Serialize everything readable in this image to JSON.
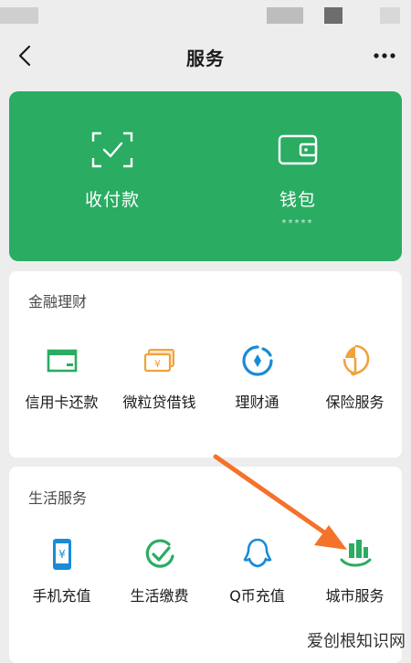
{
  "header": {
    "title": "服务"
  },
  "wallet": {
    "pay_label": "收付款",
    "wallet_label": "钱包",
    "balance_masked": "*****"
  },
  "finance": {
    "title": "金融理财",
    "items": [
      {
        "label": "信用卡还款",
        "icon": "credit-card-icon"
      },
      {
        "label": "微粒贷借钱",
        "icon": "loan-bills-icon"
      },
      {
        "label": "理财通",
        "icon": "wealth-coin-icon"
      },
      {
        "label": "保险服务",
        "icon": "insurance-icon"
      }
    ]
  },
  "life": {
    "title": "生活服务",
    "items": [
      {
        "label": "手机充值",
        "icon": "phone-topup-icon"
      },
      {
        "label": "生活缴费",
        "icon": "bill-payment-icon"
      },
      {
        "label": "Q币充值",
        "icon": "qq-coin-icon"
      },
      {
        "label": "城市服务",
        "icon": "city-services-icon"
      }
    ]
  },
  "watermark": "爱创根知识网",
  "colors": {
    "wallet_green": "#2aac62",
    "finance_blue": "#1a8bd6",
    "finance_orange": "#f0a23b",
    "life_green": "#2aac62",
    "arrow_orange": "#f5722a"
  }
}
